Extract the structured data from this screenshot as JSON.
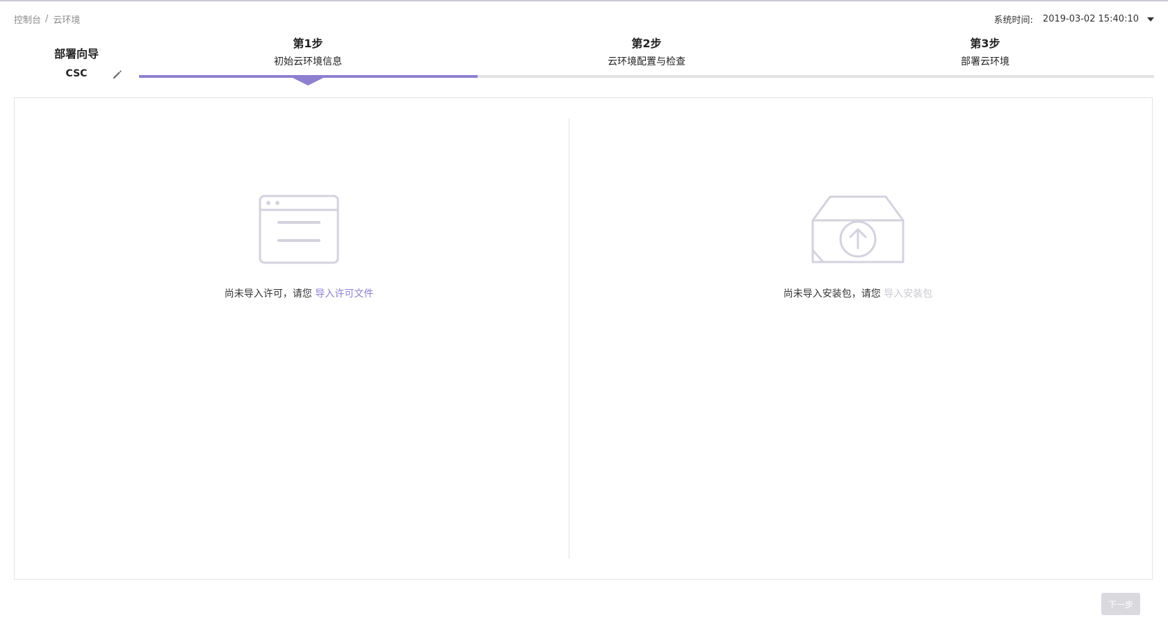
{
  "breadcrumb": {
    "items": [
      "控制台",
      "云环境"
    ],
    "separator": "/"
  },
  "system_time": {
    "label": "系统时间:",
    "value": "2019-03-02 15:40:10"
  },
  "wizard": {
    "title": "部署向导",
    "env_name": "CSC"
  },
  "steps": [
    {
      "num": "第1步",
      "title": "初始云环境信息"
    },
    {
      "num": "第2步",
      "title": "云环境配置与检查"
    },
    {
      "num": "第3步",
      "title": "部署云环境"
    }
  ],
  "progress": {
    "current_step": 1,
    "total_steps": 3
  },
  "license": {
    "message": "尚未导入许可，请您",
    "action": "导入许可文件",
    "action_color": "#8f7fd0",
    "icon": "browser-window-icon"
  },
  "package": {
    "message": "尚未导入安装包，请您",
    "action": "导入安装包",
    "action_color": "#c9c9cf",
    "icon": "box-upload-icon"
  },
  "footer": {
    "next_label": "下一步"
  },
  "colors": {
    "accent": "#8f7fd0",
    "track": "#e3e3e6",
    "disabled": "#d9d9de"
  }
}
